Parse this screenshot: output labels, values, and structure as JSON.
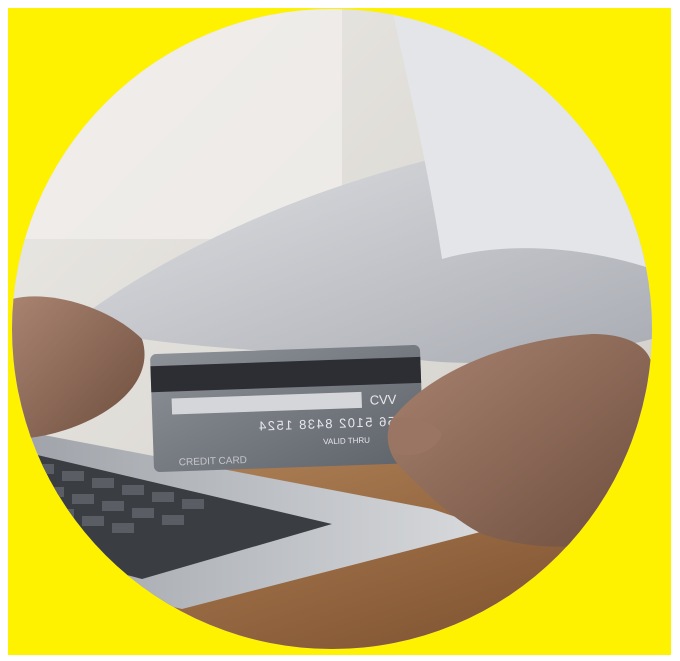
{
  "image": {
    "description_label": "credit-card-online-payment-photo",
    "colors": {
      "frame_yellow": "#fff200",
      "wall": "#dcdad5",
      "shirt": "#c9cbd0",
      "skin": "#8a6a58",
      "laptop": "#b8bcc2",
      "card": "#7a7f86",
      "card_stripe": "#2c2e33",
      "table": "#9a6b44"
    }
  },
  "card": {
    "cvv_label": "CVV",
    "number_mirrored": "4256 5102 8438 1524",
    "holder_mirrored": "CREDIT CARD",
    "small_text": "VALID THRU"
  }
}
